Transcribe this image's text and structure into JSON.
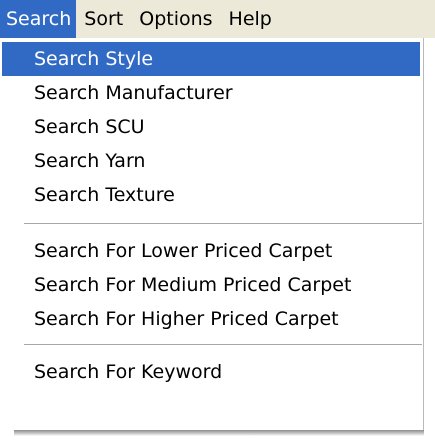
{
  "menubar": {
    "items": [
      {
        "label": "Search",
        "active": true
      },
      {
        "label": "Sort"
      },
      {
        "label": "Options"
      },
      {
        "label": "Help"
      }
    ]
  },
  "dropdown": {
    "items": [
      {
        "label": "Search Style",
        "selected": true
      },
      {
        "label": "Search Manufacturer"
      },
      {
        "label": "Search SCU"
      },
      {
        "label": "Search Yarn"
      },
      {
        "label": "Search Texture"
      },
      {
        "label": "Search For Lower Priced Carpet"
      },
      {
        "label": "Search For Medium Priced Carpet"
      },
      {
        "label": "Search For Higher Priced Carpet"
      },
      {
        "label": "Search For Keyword"
      }
    ]
  },
  "colors": {
    "highlight": "#316ac5",
    "menubar_bg": "#ece9d8",
    "menu_bg": "#ffffff"
  }
}
